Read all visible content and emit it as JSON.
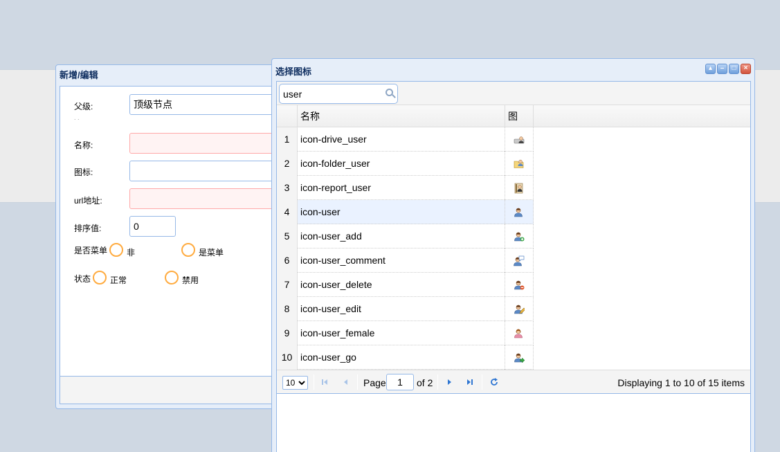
{
  "edit_window": {
    "title": "新增/编辑",
    "fields": {
      "parent_label": "父级:",
      "parent_value": "顶级节点",
      "dots": ". .",
      "name_label": "名称:",
      "icon_label": "图标:",
      "url_label": "url地址:",
      "sort_label": "排序值:",
      "sort_value": "0",
      "menu_label": "是否菜单",
      "menu_option_no": "非",
      "menu_option_yes": "是菜单",
      "status_label": "状态",
      "status_option_normal": "正常",
      "status_option_disabled": "禁用"
    }
  },
  "icon_window": {
    "title": "选择图标",
    "search_value": "user",
    "columns": {
      "name": "名称",
      "icon": "图"
    },
    "rows": [
      {
        "num": "1",
        "name": "icon-drive_user",
        "icon": "drive-user-icon"
      },
      {
        "num": "2",
        "name": "icon-folder_user",
        "icon": "folder-user-icon"
      },
      {
        "num": "3",
        "name": "icon-report_user",
        "icon": "report-user-icon"
      },
      {
        "num": "4",
        "name": "icon-user",
        "icon": "user-icon"
      },
      {
        "num": "5",
        "name": "icon-user_add",
        "icon": "user-add-icon"
      },
      {
        "num": "6",
        "name": "icon-user_comment",
        "icon": "user-comment-icon"
      },
      {
        "num": "7",
        "name": "icon-user_delete",
        "icon": "user-delete-icon"
      },
      {
        "num": "8",
        "name": "icon-user_edit",
        "icon": "user-edit-icon"
      },
      {
        "num": "9",
        "name": "icon-user_female",
        "icon": "user-female-icon"
      },
      {
        "num": "10",
        "name": "icon-user_go",
        "icon": "user-go-icon"
      }
    ],
    "selected_row": 4,
    "pager": {
      "page_size": "10",
      "page_label": "Page",
      "page_value": "1",
      "of_label": "of 2",
      "display": "Displaying 1 to 10 of 15 items"
    }
  },
  "colors": {
    "window_border": "#95b8e7",
    "radio_border": "#ffab3f",
    "invalid_bg": "#fff3f3",
    "selected_row": "#eaf2ff"
  }
}
